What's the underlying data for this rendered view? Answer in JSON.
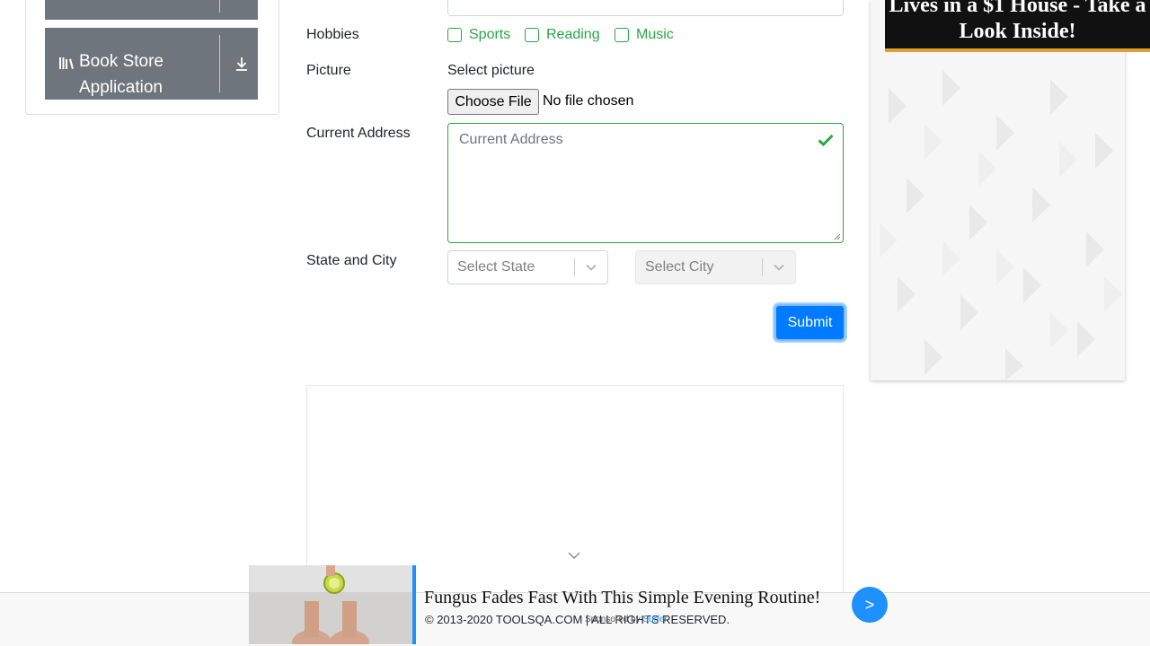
{
  "sidebar": {
    "groups": [
      {
        "label": ""
      },
      {
        "label_line1": "Book Store",
        "label_line2": "Application"
      }
    ]
  },
  "form": {
    "hobbies_label": "Hobbies",
    "hobbies": [
      "Sports",
      "Reading",
      "Music"
    ],
    "picture_label": "Picture",
    "picture_hint": "Select picture",
    "file_button": "Choose File",
    "file_status": "No file chosen",
    "address_label": "Current Address",
    "address_placeholder": "Current Address",
    "state_city_label": "State and City",
    "state_placeholder": "Select State",
    "city_placeholder": "Select City",
    "submit_label": "Submit"
  },
  "ads": {
    "right_headline": "Lives in a $1 House - Take a Look Inside!",
    "bottom_title": "Fungus Fades Fast With This Simple Evening Routine!",
    "bottom_sponsored": "Sponsored by",
    "bottom_brand": "Surfer",
    "bottom_go": ">"
  },
  "footer": {
    "copyright": "© 2013-2020 TOOLSQA.COM | ALL RIGHTS RESERVED."
  },
  "colors": {
    "accent": "#007bff",
    "valid": "#28a745",
    "sidebar_header": "#6f757d"
  }
}
